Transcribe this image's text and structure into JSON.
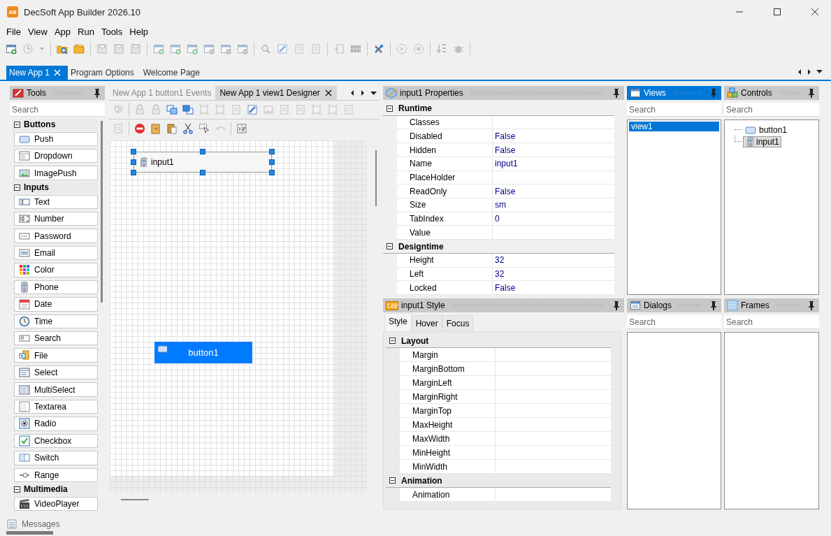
{
  "window": {
    "title": "DecSoft App Builder 2026.10",
    "logo_text": "AB"
  },
  "menu": [
    "File",
    "View",
    "App",
    "Run",
    "Tools",
    "Help"
  ],
  "document_tabs": [
    {
      "label": "New App 1",
      "selected": true
    },
    {
      "label": "Program Options",
      "selected": false
    },
    {
      "label": "Welcome Page",
      "selected": false
    }
  ],
  "tools_panel": {
    "title": "Tools",
    "search": {
      "placeholder": "Search"
    },
    "groups": [
      {
        "label": "Buttons",
        "expanded": true,
        "items": [
          "Push",
          "Dropdown",
          "ImagePush"
        ]
      },
      {
        "label": "Inputs",
        "expanded": true,
        "items": [
          "Text",
          "Number",
          "Password",
          "Email",
          "Color",
          "Phone",
          "Date",
          "Time",
          "Search",
          "File",
          "Select",
          "MultiSelect",
          "Textarea",
          "Radio",
          "Checkbox",
          "Switch",
          "Range"
        ]
      },
      {
        "label": "Multimedia",
        "expanded": true,
        "items": [
          "VideoPlayer"
        ]
      }
    ]
  },
  "designer": {
    "tabs": [
      {
        "label": "New App 1 button1 Events",
        "selected": false
      },
      {
        "label": "New App 1 view1 Designer",
        "selected": true
      }
    ],
    "controls": [
      {
        "kind": "input",
        "label": "input1",
        "selected": true
      },
      {
        "kind": "button",
        "label": "button1",
        "selected": false
      }
    ]
  },
  "properties": {
    "title": "input1 Properties",
    "sections": [
      {
        "label": "Runtime",
        "expanded": true,
        "rows": [
          {
            "name": "Classes"
          },
          {
            "name": "Disabled",
            "value": "False"
          },
          {
            "name": "Hidden",
            "value": "False"
          },
          {
            "name": "Name",
            "value": "input1"
          },
          {
            "name": "PlaceHolder"
          },
          {
            "name": "ReadOnly",
            "value": "False"
          },
          {
            "name": "Size",
            "value": "sm"
          },
          {
            "name": "TabIndex",
            "value": "0"
          },
          {
            "name": "Value"
          }
        ]
      },
      {
        "label": "Designtime",
        "expanded": true,
        "rows": [
          {
            "name": "Height",
            "value": "32"
          },
          {
            "name": "Left",
            "value": "32"
          },
          {
            "name": "Locked",
            "value": "False"
          }
        ]
      }
    ]
  },
  "style": {
    "title": "input1 Style",
    "tabs": [
      {
        "label": "Style",
        "selected": true
      },
      {
        "label": "Hover",
        "selected": false
      },
      {
        "label": "Focus",
        "selected": false
      }
    ],
    "sections": [
      {
        "label": "Layout",
        "expanded": true,
        "rows": [
          {
            "name": "Margin"
          },
          {
            "name": "MarginBottom"
          },
          {
            "name": "MarginLeft"
          },
          {
            "name": "MarginRight"
          },
          {
            "name": "MarginTop"
          },
          {
            "name": "MaxHeight"
          },
          {
            "name": "MaxWidth"
          },
          {
            "name": "MinHeight"
          },
          {
            "name": "MinWidth"
          }
        ]
      },
      {
        "label": "Animation",
        "expanded": true,
        "rows": [
          {
            "name": "Animation"
          }
        ]
      }
    ]
  },
  "views": {
    "title": "Views",
    "active": true,
    "search": {
      "placeholder": "Search"
    },
    "items": [
      {
        "label": "view1",
        "selected": true
      }
    ]
  },
  "controls": {
    "title": "Controls",
    "active": false,
    "search": {
      "placeholder": "Search"
    },
    "tree": [
      {
        "kind": "button",
        "label": "button1",
        "selected": false
      },
      {
        "kind": "input",
        "label": "input1",
        "selected": true
      }
    ]
  },
  "dialogs": {
    "title": "Dialogs",
    "active": false,
    "search": {
      "placeholder": "Search"
    }
  },
  "frames": {
    "title": "Frames",
    "active": false,
    "search": {
      "placeholder": "Search"
    }
  },
  "status_bar": {
    "label": "Messages"
  }
}
